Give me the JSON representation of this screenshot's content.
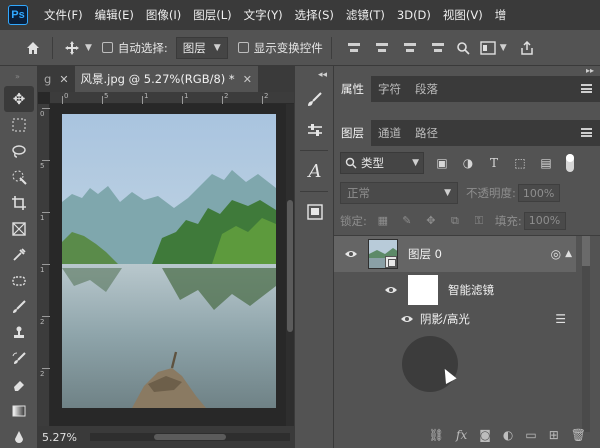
{
  "app": {
    "logo": "Ps"
  },
  "menu": [
    "文件(F)",
    "编辑(E)",
    "图像(I)",
    "图层(L)",
    "文字(Y)",
    "选择(S)",
    "滤镜(T)",
    "3D(D)",
    "视图(V)",
    "增"
  ],
  "options": {
    "auto_select_label": "自动选择:",
    "auto_select_value": "图层",
    "show_transform_label": "显示变换控件"
  },
  "tools": [
    "move-tool-icon",
    "marquee-tool-icon",
    "lasso-tool-icon",
    "quick-select-tool-icon",
    "crop-tool-icon",
    "frame-tool-icon",
    "eyedropper-tool-icon",
    "healing-tool-icon",
    "brush-tool-icon",
    "stamp-tool-icon",
    "history-brush-icon",
    "eraser-tool-icon",
    "gradient-tool-icon",
    "blur-tool-icon"
  ],
  "document": {
    "tabs": [
      {
        "label": "g",
        "active": false
      },
      {
        "label": "风景.jpg @ 5.27%(RGB/8) *",
        "active": true
      }
    ],
    "zoom": "5.27%",
    "ruler_h": [
      "0",
      "5",
      "1",
      "1",
      "2",
      "2"
    ],
    "ruler_v": [
      "0",
      "5",
      "1",
      "1",
      "2",
      "2"
    ]
  },
  "panels": {
    "top_tabs": [
      "属性",
      "字符",
      "段落"
    ],
    "layer_tabs": [
      "图层",
      "通道",
      "路径"
    ],
    "filter_label": "类型",
    "blend_mode": "正常",
    "opacity_label": "不透明度:",
    "opacity_value": "100%",
    "lock_label": "锁定:",
    "fill_label": "填充:",
    "fill_value": "100%",
    "layers": [
      {
        "name": "图层 0",
        "type": "smart-object",
        "visible": true
      },
      {
        "name": "智能滤镜",
        "type": "smart-filters",
        "visible": true
      },
      {
        "name": "阴影/高光",
        "type": "filter",
        "visible": true
      }
    ]
  },
  "colors": {
    "accent": "#31a8ff",
    "panel": "#535353",
    "dark": "#3a3a3a",
    "canvas": "#282828"
  }
}
